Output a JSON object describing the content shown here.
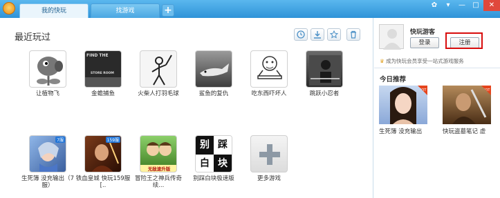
{
  "tabs": [
    {
      "label": "我的快玩"
    },
    {
      "label": "找游戏"
    }
  ],
  "add_tab": "+",
  "section": {
    "title": "最近玩过"
  },
  "games_row1": [
    {
      "name": "让植物飞"
    },
    {
      "name": "金蟾捕鱼",
      "art": "FIND THE",
      "art2": "STORE ROOM"
    },
    {
      "name": "火柴人打羽毛球"
    },
    {
      "name": "鲨鱼的复仇"
    },
    {
      "name": "吃东西吓坏人"
    },
    {
      "name": "跳跃小忍者"
    }
  ],
  "games_row2": [
    {
      "name": "生死簿 没充输出（7服）",
      "badge": "7服"
    },
    {
      "name": "铁血皇城 快玩159服 [..",
      "badge": "159服"
    },
    {
      "name": "冒险王之神兵传奇续...",
      "badge": "无敌速升版"
    },
    {
      "name": "别踩白块极速版",
      "tiles": [
        "别",
        "踩",
        "白",
        "块"
      ]
    },
    {
      "name": "更多游戏"
    }
  ],
  "user": {
    "name": "快玩游客",
    "login": "登录",
    "register": "注册"
  },
  "promo": "成为快玩会员享受一站式游戏服务",
  "today": {
    "title": "今日推荐",
    "items": [
      {
        "name": "生死簿  没充输出"
      },
      {
        "name": "快玩盗墓笔记  虚"
      }
    ],
    "hot": "HOT"
  }
}
